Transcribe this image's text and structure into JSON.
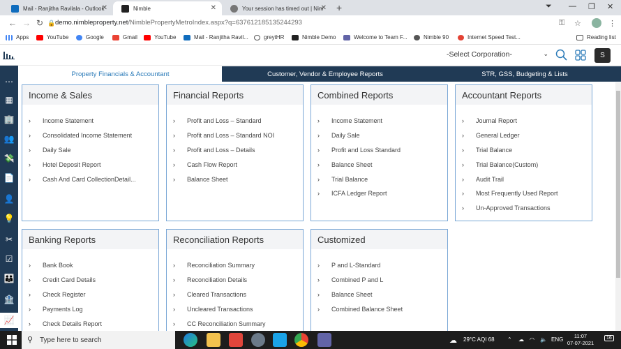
{
  "browser": {
    "tabs": [
      {
        "label": "Mail - Ranjitha Ravilala - Outlook",
        "active": false,
        "icon": "outlook-icon"
      },
      {
        "label": "Nimble",
        "active": true,
        "icon": "house-icon"
      },
      {
        "label": "Your session has timed out | Nim",
        "active": false,
        "icon": "globe-icon"
      }
    ],
    "url_host": "demo.nimbleproperty.net",
    "url_path": "/NimblePropertyMetroIndex.aspx?q=637612185135244293",
    "bookmarks": [
      {
        "label": "Apps",
        "icon": "apps-icon"
      },
      {
        "label": "YouTube",
        "icon": "youtube-icon"
      },
      {
        "label": "Google",
        "icon": "google-icon"
      },
      {
        "label": "Gmail",
        "icon": "gmail-icon"
      },
      {
        "label": "YouTube",
        "icon": "youtube-icon"
      },
      {
        "label": "Mail - Ranjitha Ravil...",
        "icon": "outlook-icon"
      },
      {
        "label": "greytHR",
        "icon": "greythr-icon"
      },
      {
        "label": "Nimble Demo",
        "icon": "house-icon"
      },
      {
        "label": "Welcome to Team F...",
        "icon": "teams-icon"
      },
      {
        "label": "Nimble 90",
        "icon": "globe-icon"
      },
      {
        "label": "Internet Speed Test...",
        "icon": "speedtest-icon"
      }
    ],
    "reading_list": "Reading list"
  },
  "header": {
    "corporation_select": "-Select Corporation-",
    "avatar_initial": "S"
  },
  "tabs": [
    {
      "label": "Property Financials & Accountant",
      "active": true
    },
    {
      "label": "Customer, Vendor & Employee Reports",
      "active": false
    },
    {
      "label": "STR, GSS, Budgeting & Lists",
      "active": false
    }
  ],
  "cards": [
    {
      "title": "Income & Sales",
      "items": [
        "Income Statement",
        "Consolidated Income Statement",
        "Daily Sale",
        "Hotel Deposit Report",
        "Cash And Card CollectionDetail..."
      ]
    },
    {
      "title": "Financial Reports",
      "items": [
        "Profit and Loss – Standard",
        "Profit and Loss – Standard NOI",
        "Profit and Loss – Details",
        "Cash Flow Report",
        "Balance Sheet"
      ]
    },
    {
      "title": "Combined Reports",
      "items": [
        "Income Statement",
        "Daily Sale",
        "Profit and Loss Standard",
        "Balance Sheet",
        "Trial Balance",
        "ICFA Ledger Report"
      ]
    },
    {
      "title": "Accountant Reports",
      "items": [
        "Journal Report",
        "General Ledger",
        "Trial Balance",
        "Trial Balance(Custom)",
        "Audit Trail",
        "Most Frequently Used Report",
        "Un-Approved Transactions"
      ]
    },
    {
      "title": "Banking Reports",
      "items": [
        "Bank Book",
        "Credit Card Details",
        "Check Register",
        "Payments Log",
        "Check Details Report"
      ]
    },
    {
      "title": "Reconciliation Reports",
      "items": [
        "Reconciliation Summary",
        "Reconciliation Details",
        "Cleared Transactions",
        "Uncleared Transactions",
        "CC Reconciliation Summary"
      ]
    },
    {
      "title": "Customized",
      "items": [
        "P and L-Standard",
        "Combined P and L",
        "Balance Sheet",
        "Combined Balance Sheet"
      ]
    }
  ],
  "taskbar": {
    "search_placeholder": "Type here to search",
    "weather": "29°C  AQI 68",
    "language": "ENG",
    "time": "11:07",
    "date": "07-07-2021",
    "notifications": "16"
  },
  "colors": {
    "sidebar": "#203a55",
    "accent": "#2a7ab8",
    "card_border": "#7aa7d6"
  }
}
